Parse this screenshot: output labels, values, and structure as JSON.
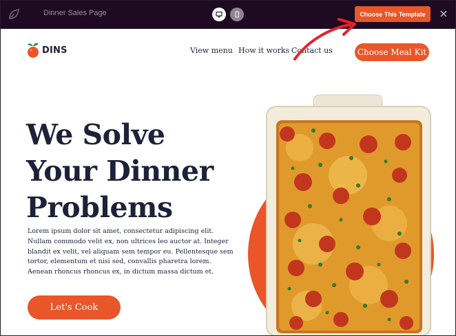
{
  "builder": {
    "page_name": "Dinner Sales Page",
    "choose_template_label": "Choose This Template",
    "icons": {
      "logo": "leaf-logo-icon",
      "desktop": "desktop-icon",
      "mobile": "mobile-icon",
      "close": "close-icon"
    }
  },
  "site": {
    "brand": "DINS",
    "nav": [
      "View menu",
      "How it works",
      "Contact us"
    ],
    "cta_label": "Choose Meal Kit"
  },
  "hero": {
    "headline_lines": [
      "We Solve",
      "Your Dinner",
      "Problems"
    ],
    "body": "Lorem ipsum dolor sit amet, consectetur adipiscing elit. Nullam commodo velit ex, non ultrices leo auctor at. Integer blandit ex velit, vel aliquam sem tempor eu. Pellentesque sem tortor, elementum et nisi sed, convallis pharetra lorem. Aenean rhoncus rhoncus ex, in dictum massa dictum et.",
    "button_label": "Let's Cook"
  },
  "colors": {
    "accent": "#e8562a",
    "topbar": "#1e0b22",
    "text": "#1d2238"
  }
}
